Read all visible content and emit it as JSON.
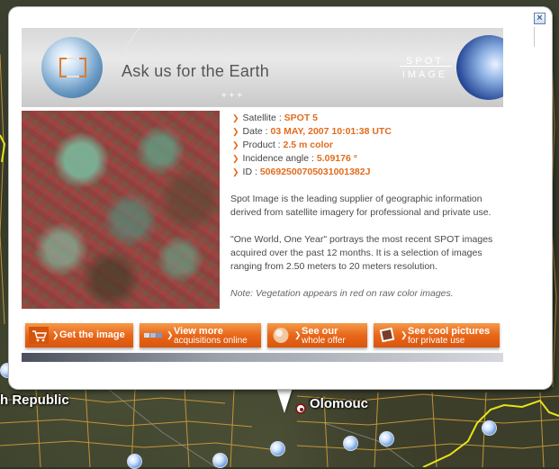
{
  "map": {
    "labels": {
      "republic": "h Republic",
      "olomouc": "Olomouc"
    }
  },
  "balloon": {
    "close_label": "×",
    "banner": {
      "slogan": "Ask us for the Earth",
      "brand_line1": "SPOT",
      "brand_line2": "IMAGE",
      "stars": "+    +    +"
    },
    "info": [
      {
        "label": "Satellite : ",
        "value": "SPOT 5"
      },
      {
        "label": "Date : ",
        "value": "03 MAY, 2007 10:01:38 UTC"
      },
      {
        "label": "Product : ",
        "value": "2.5 m color"
      },
      {
        "label": "Incidence angle : ",
        "value": "5.09176 °"
      },
      {
        "label": "ID : ",
        "value": "50692500705031001382J"
      }
    ],
    "description": "Spot Image is the leading supplier of geographic information derived from satellite imagery for professional and private use.",
    "one_world": "\"One World, One Year\" portrays the most recent SPOT images acquired over the past 12 months. It is a selection of images ranging from 2.50 meters to 20 meters resolution.",
    "note": "Note: Vegetation appears in red on raw color images.",
    "buttons": {
      "get_image": "Get the image",
      "view_more_1": "View more",
      "view_more_2": "acquisitions online",
      "see_offer_1": "See our",
      "see_offer_2": "whole offer",
      "cool_pics_1": "See cool pictures",
      "cool_pics_2": "for private use"
    }
  },
  "colors": {
    "accent": "#e36b1c",
    "button": "#e8671a"
  }
}
